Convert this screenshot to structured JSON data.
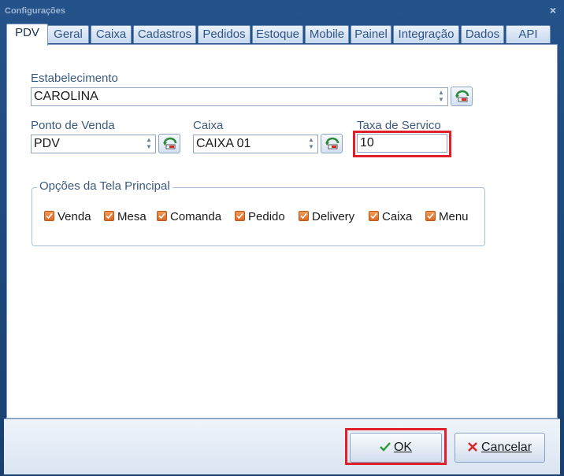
{
  "window": {
    "title": "Configurações",
    "close_glyph": "×"
  },
  "tabs": [
    {
      "label": "PDV",
      "active": true
    },
    {
      "label": "Geral"
    },
    {
      "label": "Caixa"
    },
    {
      "label": "Cadastros"
    },
    {
      "label": "Pedidos"
    },
    {
      "label": "Estoque"
    },
    {
      "label": "Mobile"
    },
    {
      "label": "Painel"
    },
    {
      "label": "Integração"
    },
    {
      "label": "Dados"
    },
    {
      "label": "API"
    }
  ],
  "pdv": {
    "estabelecimento": {
      "label": "Estabelecimento",
      "value": "CAROLINA",
      "icon": "refresh-lookup-icon"
    },
    "ponto_venda": {
      "label": "Ponto de Venda",
      "value": "PDV",
      "icon": "refresh-lookup-icon"
    },
    "caixa": {
      "label": "Caixa",
      "value": "CAIXA 01",
      "icon": "refresh-lookup-icon"
    },
    "taxa_servico": {
      "label": "Taxa de Servico",
      "value": "10"
    },
    "opcoes": {
      "title": "Opções da Tela Principal",
      "items": [
        {
          "label": "Venda",
          "checked": true
        },
        {
          "label": "Mesa",
          "checked": true
        },
        {
          "label": "Comanda",
          "checked": true
        },
        {
          "label": "Pedido",
          "checked": true
        },
        {
          "label": "Delivery",
          "checked": true
        },
        {
          "label": "Caixa",
          "checked": true
        },
        {
          "label": "Menu",
          "checked": true
        }
      ]
    }
  },
  "footer": {
    "ok_label": "OK",
    "cancel_label": "Cancelar",
    "ok_icon": "checkmark-icon",
    "cancel_icon": "x-icon"
  },
  "colors": {
    "highlight": "#e0212b",
    "checkbox": "#e3772f",
    "titlebar": "#1f4a80"
  }
}
